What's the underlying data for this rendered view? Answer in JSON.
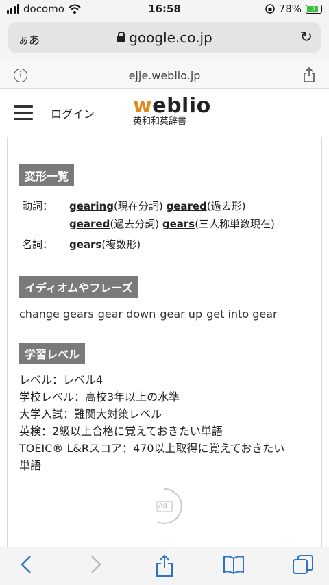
{
  "status": {
    "carrier": "docomo",
    "time": "16:58",
    "battery": "78%"
  },
  "browser": {
    "aa": "ぁあ",
    "url": "google.co.jp"
  },
  "site": {
    "domain": "ejje.weblio.jp"
  },
  "header": {
    "login": "ログイン",
    "logo_w": "w",
    "logo_rest": "eblio",
    "logo_sub": "英和和英辞書"
  },
  "inflections": {
    "title": "変形一覧",
    "verb_label": "動詞：",
    "noun_label": "名詞：",
    "v1": "gearing",
    "v1n": "(現在分詞) ",
    "v2": "geared",
    "v2n": "(過去形)",
    "v3": "geared",
    "v3n": "(過去分詞) ",
    "v4": "gears",
    "v4n": "(三人称単数現在)",
    "n1": "gears",
    "n1n": "(複数形)"
  },
  "idioms": {
    "title": "イディオムやフレーズ",
    "items": [
      "change gears",
      "gear down",
      "gear up",
      "get into gear"
    ]
  },
  "level": {
    "title": "学習レベル",
    "lines": [
      "レベル：レベル4",
      "学校レベル：高校3年以上の水準",
      "大学入試：難関大対策レベル",
      "英検：2級以上合格に覚えておきたい単語",
      "TOEIC® L&Rスコア：470以上取得に覚えておきたい",
      "単語"
    ]
  },
  "ad": {
    "label": "Ad"
  }
}
